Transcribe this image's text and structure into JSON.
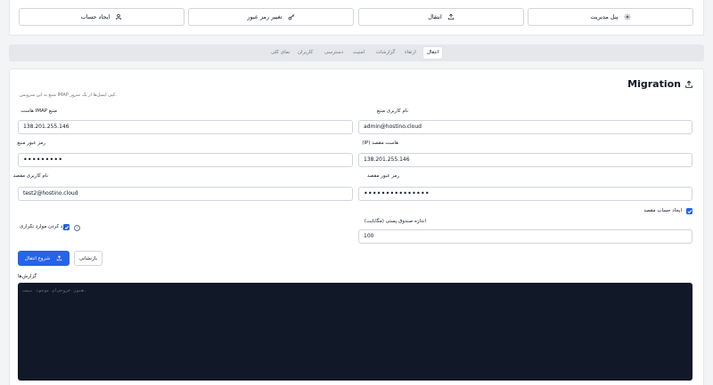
{
  "quick_actions": [
    {
      "label": "پنل مدیریت",
      "icon": "gear-icon"
    },
    {
      "label": "انتقال",
      "icon": "upload-icon"
    },
    {
      "label": "تغییر رمز عبور",
      "icon": "key-icon"
    },
    {
      "label": "ایجاد حساب",
      "icon": "user-icon"
    }
  ],
  "tabs": [
    {
      "label": "انتقال",
      "active": true
    },
    {
      "label": "ارتقاء",
      "active": false
    },
    {
      "label": "گزارشات",
      "active": false
    },
    {
      "label": "امنیت",
      "active": false
    },
    {
      "label": "دسترسی",
      "active": false
    },
    {
      "label": "کاربران",
      "active": false
    },
    {
      "label": "نمای کلی",
      "active": false
    }
  ],
  "migration": {
    "title": "Migration",
    "description": "منبع به این سرویس IMAP کپی ایمیل‌ها از یک سرور.",
    "source_user_label": "نام کاربری منبع",
    "source_user_value": "admin@hostino.cloud",
    "source_host_label": "منبع IMAP هاست",
    "source_host_value": "138.201.255.146",
    "target_host_label": "هاست مقصد (IP)",
    "target_host_value": "138.201.255.146",
    "source_pass_label": "رمز عبور منبع",
    "source_pass_value": "•••••••••",
    "target_pass_label": "رمز عبور مقصد",
    "target_pass_value": "•••••••••••••••",
    "target_user_label": "نام کاربری مقصد",
    "target_user_value": "test2@hostino.cloud",
    "create_account_label": "ایجاد حساب مقصد",
    "create_account_checked": true,
    "skip_dupes_label": "رد کردن موارد تکراری",
    "skip_dupes_checked": true,
    "mailbox_size_label": "اندازه صندوق پستی (مگابایت)",
    "mailbox_size_value": "100",
    "start_button": "شروع انتقال",
    "reset_button": "بازنشانی",
    "logs_label": "گزارش‌ها",
    "logs_placeholder": "هنوز خروجی‌ای موجود نیست."
  },
  "colors": {
    "accent": "#2563eb",
    "console_bg": "#111827"
  }
}
